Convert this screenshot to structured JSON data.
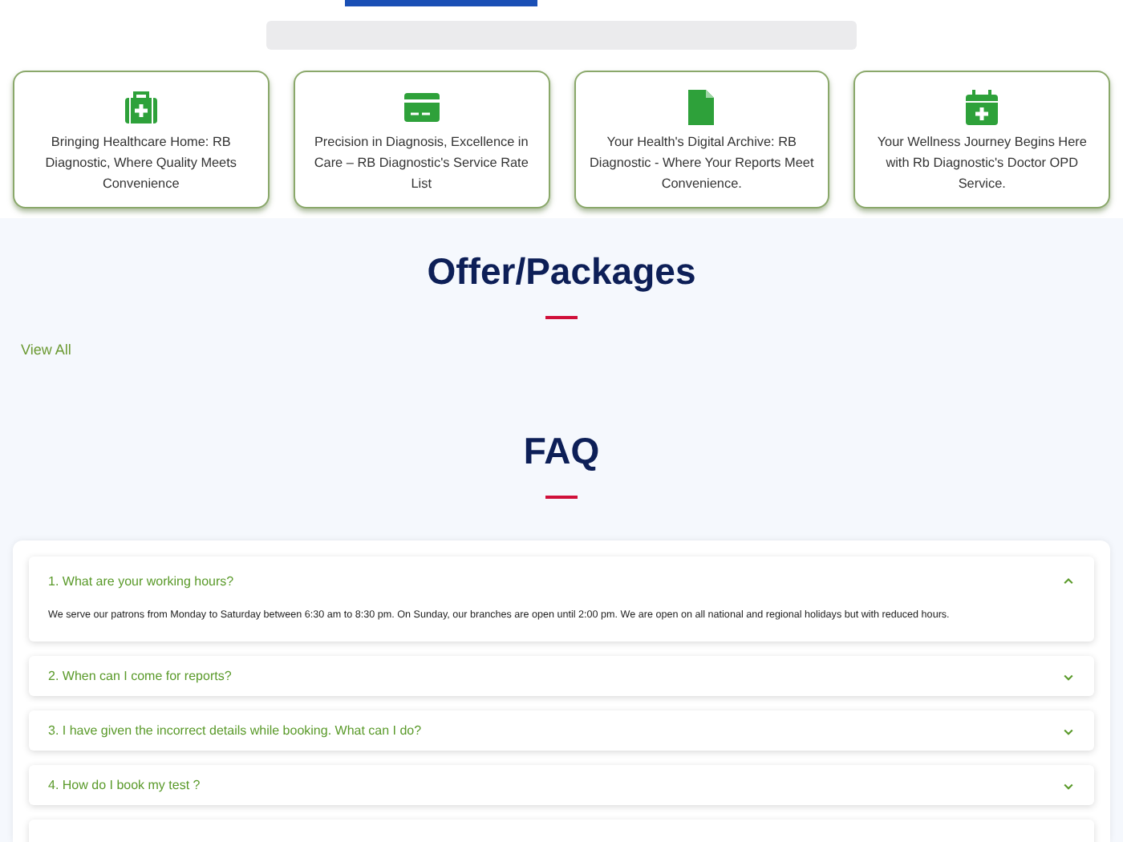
{
  "services": [
    {
      "kind": "bag",
      "text": "Bringing Healthcare Home: RB Diagnostic, Where Quality Meets Convenience"
    },
    {
      "kind": "card",
      "text": "Precision in Diagnosis, Excellence in Care – RB Diagnostic's Service Rate List"
    },
    {
      "kind": "document",
      "text": "Your Health's Digital Archive: RB Diagnostic - Where Your Reports Meet Convenience."
    },
    {
      "kind": "calendar",
      "text": "Your Wellness Journey Begins Here with Rb Diagnostic's Doctor OPD Service."
    }
  ],
  "offers": {
    "title": "Offer/Packages",
    "link": "View All"
  },
  "faq": {
    "title": "FAQ",
    "items": [
      {
        "question": "1. What are your working hours?",
        "expanded": true,
        "answer": "We serve our patrons from Monday to Saturday between 6:30 am to 8:30 pm. On Sunday, our branches are open until 2:00 pm. We are open on all national and regional holidays but with reduced hours."
      },
      {
        "question": "2. When can I come for reports?",
        "expanded": false
      },
      {
        "question": "3. I have given the incorrect details while booking. What can I do?",
        "expanded": false
      },
      {
        "question": "4. How do I book my test ?",
        "expanded": false
      }
    ]
  }
}
